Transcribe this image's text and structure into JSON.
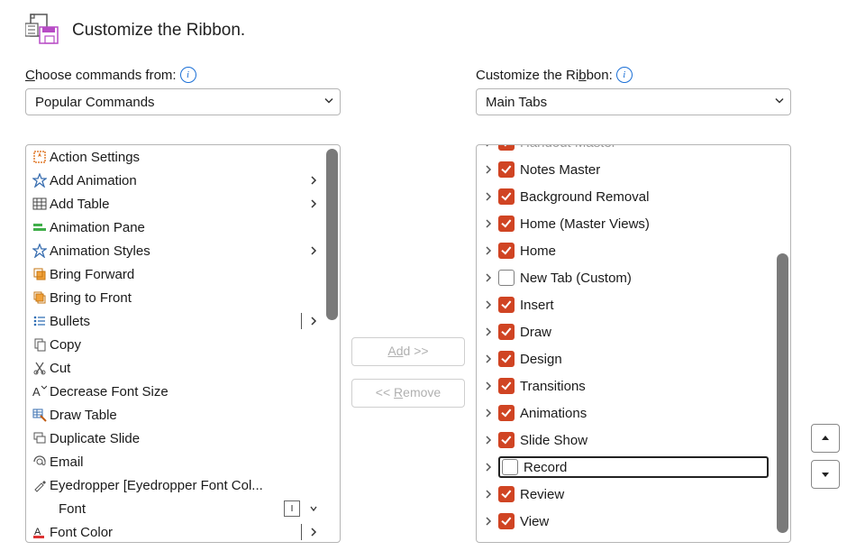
{
  "header": {
    "title": "Customize the Ribbon."
  },
  "left": {
    "label_pre": "C",
    "label_und": "",
    "label_rest": "hoose commands from:",
    "combo": "Popular Commands",
    "commands": [
      {
        "icon": "action-settings",
        "label": "Action Settings",
        "submenu": false
      },
      {
        "icon": "add-animation",
        "label": "Add Animation",
        "submenu": true
      },
      {
        "icon": "add-table",
        "label": "Add Table",
        "submenu": true
      },
      {
        "icon": "animation-pane",
        "label": "Animation Pane",
        "submenu": false
      },
      {
        "icon": "animation-styles",
        "label": "Animation Styles",
        "submenu": true
      },
      {
        "icon": "bring-forward",
        "label": "Bring Forward",
        "submenu": false
      },
      {
        "icon": "bring-front",
        "label": "Bring to Front",
        "submenu": false
      },
      {
        "icon": "bullets",
        "label": "Bullets",
        "submenu": true,
        "split": true
      },
      {
        "icon": "copy",
        "label": "Copy",
        "submenu": false
      },
      {
        "icon": "cut",
        "label": "Cut",
        "submenu": false
      },
      {
        "icon": "decrease-font",
        "label": "Decrease Font Size",
        "submenu": false
      },
      {
        "icon": "draw-table",
        "label": "Draw Table",
        "submenu": false
      },
      {
        "icon": "duplicate-slide",
        "label": "Duplicate Slide",
        "submenu": false
      },
      {
        "icon": "email",
        "label": "Email",
        "submenu": false
      },
      {
        "icon": "eyedropper",
        "label": "Eyedropper [Eyedropper Font Col...",
        "submenu": false
      },
      {
        "icon": "none",
        "label": "Font",
        "submenu": false,
        "glyph": "I"
      },
      {
        "icon": "font-color",
        "label": "Font Color",
        "submenu": true,
        "split": true
      }
    ]
  },
  "right": {
    "label_pre": "Customize the Ri",
    "label_und": "b",
    "label_rest": "bon:",
    "combo": "Main Tabs",
    "tabs_cut": [
      {
        "label": "Handout Master",
        "checked": true
      }
    ],
    "tabs": [
      {
        "label": "Notes Master",
        "checked": true
      },
      {
        "label": "Background Removal",
        "checked": true
      },
      {
        "label": "Home (Master Views)",
        "checked": true
      },
      {
        "label": "Home",
        "checked": true
      },
      {
        "label": "New Tab (Custom)",
        "checked": false
      },
      {
        "label": "Insert",
        "checked": true
      },
      {
        "label": "Draw",
        "checked": true
      },
      {
        "label": "Design",
        "checked": true
      },
      {
        "label": "Transitions",
        "checked": true
      },
      {
        "label": "Animations",
        "checked": true
      },
      {
        "label": "Slide Show",
        "checked": true
      },
      {
        "label": "Record",
        "checked": false,
        "selected": true
      },
      {
        "label": "Review",
        "checked": true
      },
      {
        "label": "View",
        "checked": true
      }
    ]
  },
  "middle": {
    "add_pre": "A",
    "add_und": "d",
    "add_rest": "d >>",
    "remove": "<< Remove",
    "remove_und": "R"
  }
}
